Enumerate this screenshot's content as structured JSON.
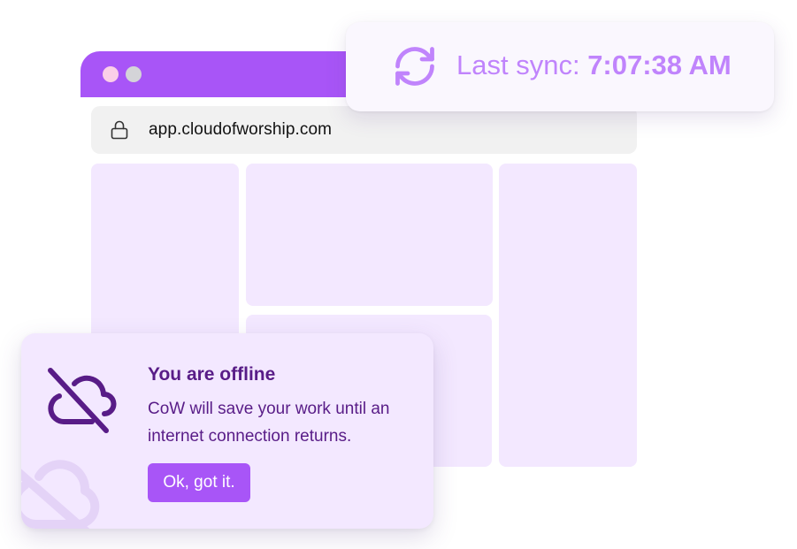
{
  "colors": {
    "accent": "#a855f7",
    "accent_light": "#c084fc",
    "panel_fill": "#f3e8ff",
    "dark_text": "#581c87"
  },
  "browser": {
    "window_controls": [
      "close-dot",
      "minimize-dot"
    ],
    "address_bar": {
      "icon": "lock-icon",
      "url": "app.cloudofworship.com"
    }
  },
  "sync_status": {
    "icon": "refresh-icon",
    "label": "Last sync: ",
    "time": "7:07:38 AM"
  },
  "offline_notice": {
    "icon": "cloud-off-icon",
    "title": "You are offline",
    "message": "CoW will save your work until an internet connection returns.",
    "button_label": "Ok, got it."
  }
}
